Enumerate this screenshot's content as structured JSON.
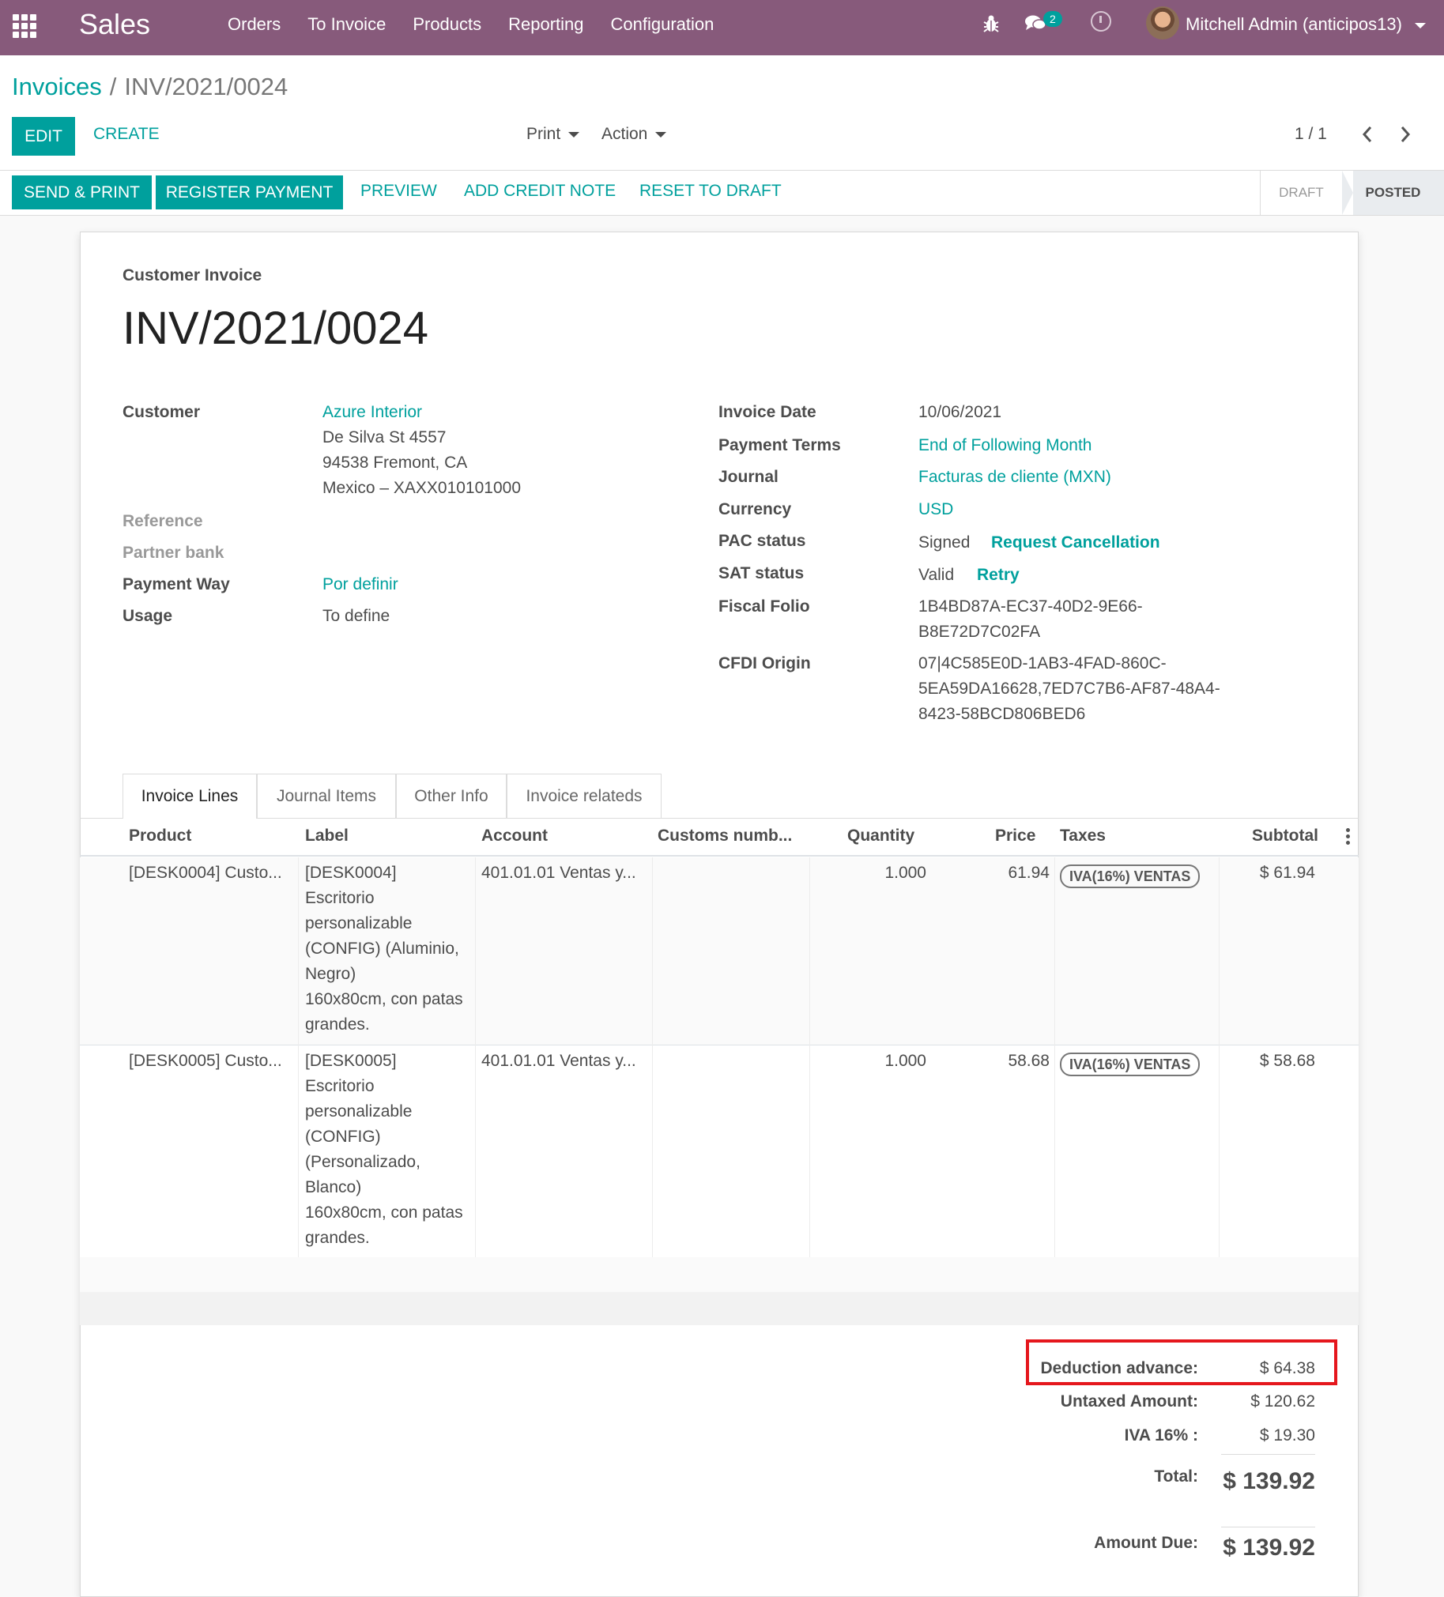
{
  "navbar": {
    "app_name": "Sales",
    "menu": [
      "Orders",
      "To Invoice",
      "Products",
      "Reporting",
      "Configuration"
    ],
    "chat_count": "2",
    "user": "Mitchell Admin (anticipos13)",
    "icons": [
      "apps-grid-icon",
      "bug-icon",
      "chat-icon",
      "clock-icon",
      "user-avatar"
    ]
  },
  "breadcrumb": {
    "parent": "Invoices",
    "separator": "/",
    "current": "INV/2021/0024"
  },
  "toolbar": {
    "edit": "EDIT",
    "create": "CREATE",
    "print": "Print",
    "action": "Action",
    "pager": "1 / 1"
  },
  "statusbar": {
    "send_print": "SEND & PRINT",
    "register_payment": "REGISTER PAYMENT",
    "preview": "PREVIEW",
    "add_credit_note": "ADD CREDIT NOTE",
    "reset_to_draft": "RESET TO DRAFT",
    "stage_draft": "DRAFT",
    "stage_posted": "POSTED"
  },
  "invoice": {
    "type": "Customer Invoice",
    "number": "INV/2021/0024",
    "left": {
      "customer_label": "Customer",
      "customer_name": "Azure Interior",
      "address": [
        "De Silva St 4557",
        "94538 Fremont, CA",
        "Mexico – XAXX010101000"
      ],
      "reference_label": "Reference",
      "partner_bank_label": "Partner bank",
      "payment_way_label": "Payment Way",
      "payment_way": "Por definir",
      "usage_label": "Usage",
      "usage": "To define"
    },
    "right": {
      "invoice_date_label": "Invoice Date",
      "invoice_date": "10/06/2021",
      "payment_terms_label": "Payment Terms",
      "payment_terms": "End of Following Month",
      "journal_label": "Journal",
      "journal": "Facturas de cliente (MXN)",
      "currency_label": "Currency",
      "currency": "USD",
      "pac_status_label": "PAC status",
      "pac_status": "Signed",
      "pac_action": "Request Cancellation",
      "sat_status_label": "SAT status",
      "sat_status": "Valid",
      "sat_action": "Retry",
      "fiscal_folio_label": "Fiscal Folio",
      "fiscal_folio": [
        "1B4BD87A-EC37-40D2-9E66-",
        "B8E72D7C02FA"
      ],
      "cfdi_origin_label": "CFDI Origin",
      "cfdi_origin": [
        "07|4C585E0D-1AB3-4FAD-860C-",
        "5EA59DA16628,7ED7C7B6-AF87-48A4-",
        "8423-58BCD806BED6"
      ]
    }
  },
  "tabs": [
    "Invoice Lines",
    "Journal Items",
    "Other Info",
    "Invoice relateds"
  ],
  "lines": {
    "columns": [
      "Product",
      "Label",
      "Account",
      "Customs numb...",
      "Quantity",
      "Price",
      "Taxes",
      "Subtotal"
    ],
    "rows": [
      {
        "product": "[DESK0004] Custo...",
        "label": [
          "[DESK0004]",
          "Escritorio",
          "personalizable",
          "(CONFIG) (Aluminio,",
          "Negro)",
          "160x80cm, con patas",
          "grandes."
        ],
        "account": "401.01.01 Ventas y...",
        "quantity": "1.000",
        "price": "61.94",
        "tax": "IVA(16%) VENTAS",
        "subtotal": "$ 61.94"
      },
      {
        "product": "[DESK0005] Custo...",
        "label": [
          "[DESK0005]",
          "Escritorio",
          "personalizable",
          "(CONFIG)",
          "(Personalizado,",
          "Blanco)",
          "160x80cm, con patas",
          "grandes."
        ],
        "account": "401.01.01 Ventas y...",
        "quantity": "1.000",
        "price": "58.68",
        "tax": "IVA(16%) VENTAS",
        "subtotal": "$ 58.68"
      }
    ]
  },
  "totals": {
    "deduction_label": "Deduction advance:",
    "deduction": "$ 64.38",
    "untaxed_label": "Untaxed Amount:",
    "untaxed": "$ 120.62",
    "iva_label": "IVA 16% :",
    "iva": "$ 19.30",
    "total_label": "Total:",
    "total": "$ 139.92",
    "due_label": "Amount Due:",
    "due": "$ 139.92"
  },
  "colors": {
    "brand": "#875a7b",
    "accent": "#00a09d",
    "highlight": "#e5171d"
  }
}
